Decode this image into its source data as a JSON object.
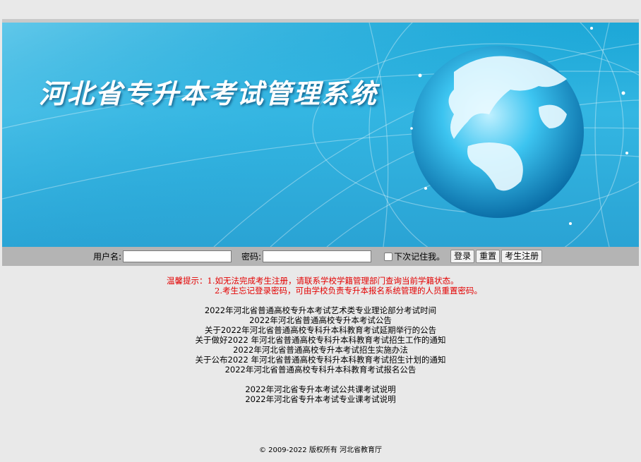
{
  "banner": {
    "title": "河北省专升本考试管理系统"
  },
  "login": {
    "username_label": "用户名:",
    "username_value": "",
    "password_label": "密码:",
    "password_value": "",
    "remember_label": "下次记住我。",
    "login_button": "登录",
    "reset_button": "重置",
    "register_button": "考生注册"
  },
  "tips": {
    "line1": "温馨提示：1.如无法完成考生注册，请联系学校学籍管理部门查询当前学籍状态。",
    "line2": "2.考生忘记登录密码，可由学校负责专升本报名系统管理的人员重置密码。"
  },
  "notices": [
    "2022年河北省普通高校专升本考试艺术类专业理论部分考试时间",
    "2022年河北省普通高校专升本考试公告",
    "关于2022年河北省普通高校专科升本科教育考试延期举行的公告",
    "关于做好2022 年河北省普通高校专科升本科教育考试招生工作的通知",
    "2022年河北省普通高校专升本考试招生实施办法",
    "关于公布2022 年河北省普通高校专科升本科教育考试招生计划的通知",
    "2022年河北省普通高校专科升本科教育考试报名公告"
  ],
  "explanations": [
    "2022年河北省专升本考试公共课考试说明",
    "2022年河北省专升本考试专业课考试说明"
  ],
  "footer": {
    "copyright": "© 2009-2022 版权所有 河北省教育厅"
  },
  "colors": {
    "tip_text": "#e30000",
    "banner_blue": "#2aa3d4",
    "login_bar": "#b4b4b4",
    "page_bg": "#e9e9e9"
  }
}
